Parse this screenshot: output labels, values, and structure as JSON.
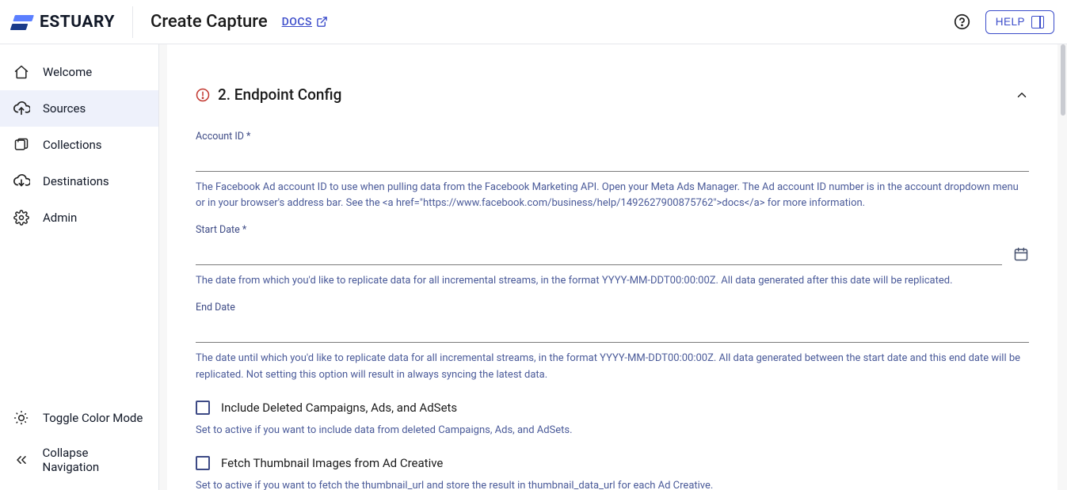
{
  "brand": "ESTUARY",
  "header": {
    "title": "Create Capture",
    "docs_label": "DOCS",
    "help_label": "HELP"
  },
  "sidebar": {
    "items": [
      {
        "label": "Welcome",
        "icon": "home"
      },
      {
        "label": "Sources",
        "icon": "upload-cloud",
        "active": true
      },
      {
        "label": "Collections",
        "icon": "layers"
      },
      {
        "label": "Destinations",
        "icon": "download-cloud"
      },
      {
        "label": "Admin",
        "icon": "gear"
      }
    ],
    "toggle_color_label": "Toggle Color Mode",
    "collapse_label": "Collapse Navigation"
  },
  "main": {
    "section_title": "2. Endpoint Config",
    "fields": {
      "account_id": {
        "label": "Account ID *",
        "help": "The Facebook Ad account ID to use when pulling data from the Facebook Marketing API. Open your Meta Ads Manager. The Ad account ID number is in the account dropdown menu or in your browser's address bar. See the <a href=\"https://www.facebook.com/business/help/1492627900875762\">docs</a> for more information."
      },
      "start_date": {
        "label": "Start Date *",
        "help": "The date from which you'd like to replicate data for all incremental streams, in the format YYYY-MM-DDT00:00:00Z. All data generated after this date will be replicated."
      },
      "end_date": {
        "label": "End Date",
        "help": "The date until which you'd like to replicate data for all incremental streams, in the format YYYY-MM-DDT00:00:00Z. All data generated between the start date and this end date will be replicated. Not setting this option will result in always syncing the latest data."
      },
      "include_deleted": {
        "label": "Include Deleted Campaigns, Ads, and AdSets",
        "help": "Set to active if you want to include data from deleted Campaigns, Ads, and AdSets."
      },
      "fetch_thumbnails": {
        "label": "Fetch Thumbnail Images from Ad Creative",
        "help": "Set to active if you want to fetch the thumbnail_url and store the result in thumbnail_data_url for each Ad Creative."
      }
    }
  }
}
